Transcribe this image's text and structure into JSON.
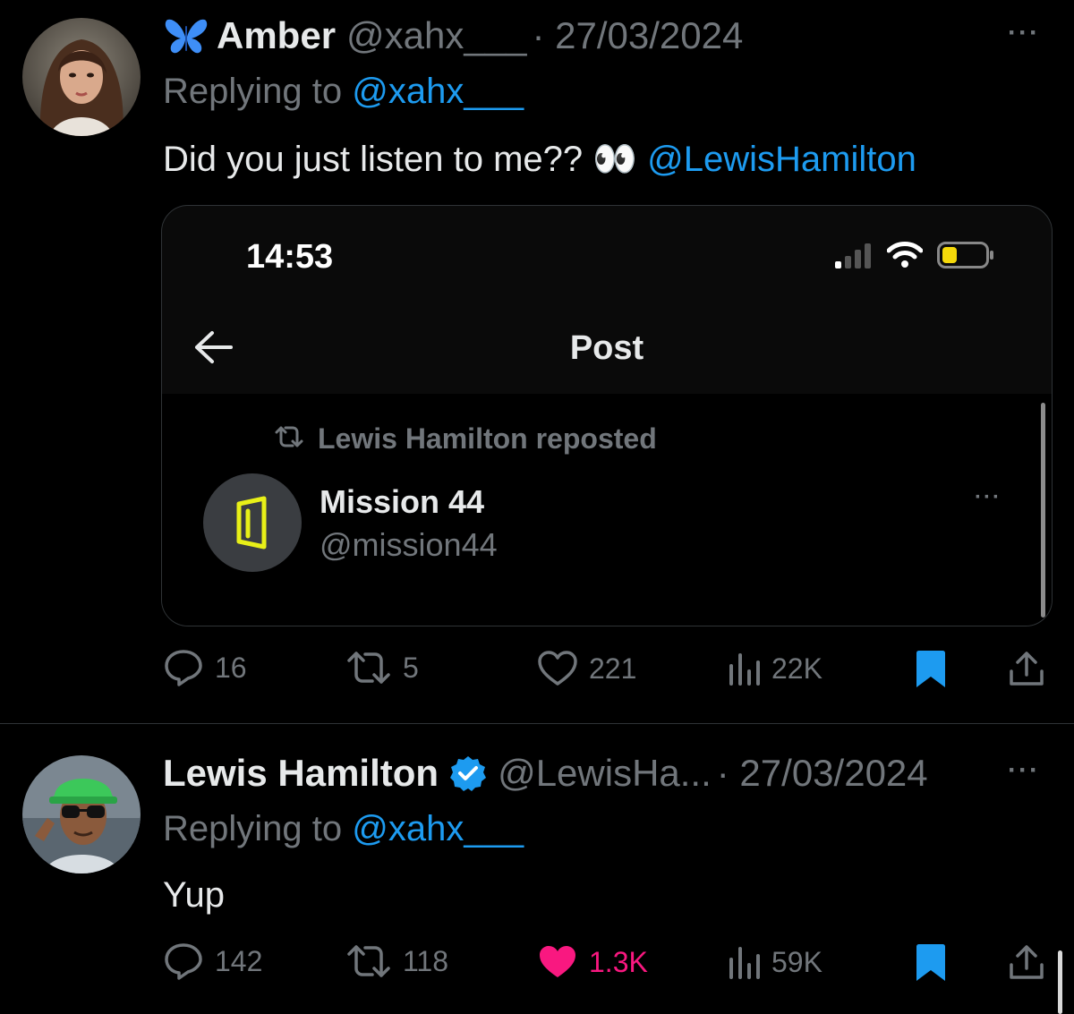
{
  "tweet1": {
    "display_name": "Amber",
    "handle": "@xahx___",
    "date": "· 27/03/2024",
    "replying_prefix": "Replying to ",
    "replying_handle": "@xahx___",
    "body_text": "Did you just listen to me?? 👀 ",
    "body_mention": "@LewisHamilton",
    "badge_icon": "butterfly-icon",
    "more_label": "···",
    "embed": {
      "time": "14:53",
      "header_title": "Post",
      "repost_label": "Lewis Hamilton reposted",
      "author_name": "Mission 44",
      "author_handle": "@mission44",
      "more_label": "···"
    },
    "actions": {
      "replies": "16",
      "reposts": "5",
      "likes": "221",
      "views": "22K"
    }
  },
  "tweet2": {
    "display_name": "Lewis Hamilton",
    "handle": "@LewisHa...",
    "date": "· 27/03/2024",
    "replying_prefix": "Replying to ",
    "replying_handle": "@xahx___",
    "body_text": "Yup",
    "verified_icon": "verified-badge-icon",
    "more_label": "···",
    "actions": {
      "replies": "142",
      "reposts": "118",
      "likes": "1.3K",
      "views": "59K"
    }
  },
  "colors": {
    "background": "#000000",
    "text": "#e7e9ea",
    "muted": "#71767b",
    "link": "#1d9bf0",
    "like_active": "#f91880",
    "bookmark": "#1d9bf0",
    "mission_yellow": "#e8f018"
  }
}
